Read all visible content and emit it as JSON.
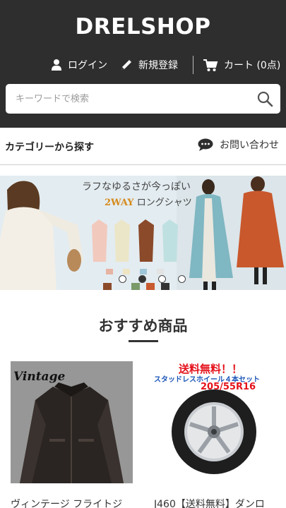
{
  "header": {
    "shop_name": "DRELSHOP",
    "login_label": "ログイン",
    "signup_label": "新規登録",
    "cart_label": "カート (0点)"
  },
  "search": {
    "placeholder": "キーワードで検索"
  },
  "subnav": {
    "category_label": "カテゴリーから探す",
    "contact_label": "お問い合わせ"
  },
  "banner": {
    "catch_copy": "ラフなゆるさが今っぽい",
    "sub_en": "2WAY",
    "sub_jp": "ロングシャツ",
    "slide_count": 4,
    "active_slide": 2
  },
  "recommended": {
    "title": "おすすめ商品",
    "products": [
      {
        "name": "ヴィンテージ フライトジ",
        "image_label": "Vintage"
      },
      {
        "name": "J460【送料無料】ダンロ",
        "image_promo_1": "送料無料！！",
        "image_promo_2": "スタッドレスホイール４本セット",
        "image_promo_3": "205/55R16"
      }
    ]
  },
  "colors": {
    "header_bg": "#2e2e2e",
    "promo_red": "#e5121b",
    "promo_blue": "#1b55b8"
  }
}
